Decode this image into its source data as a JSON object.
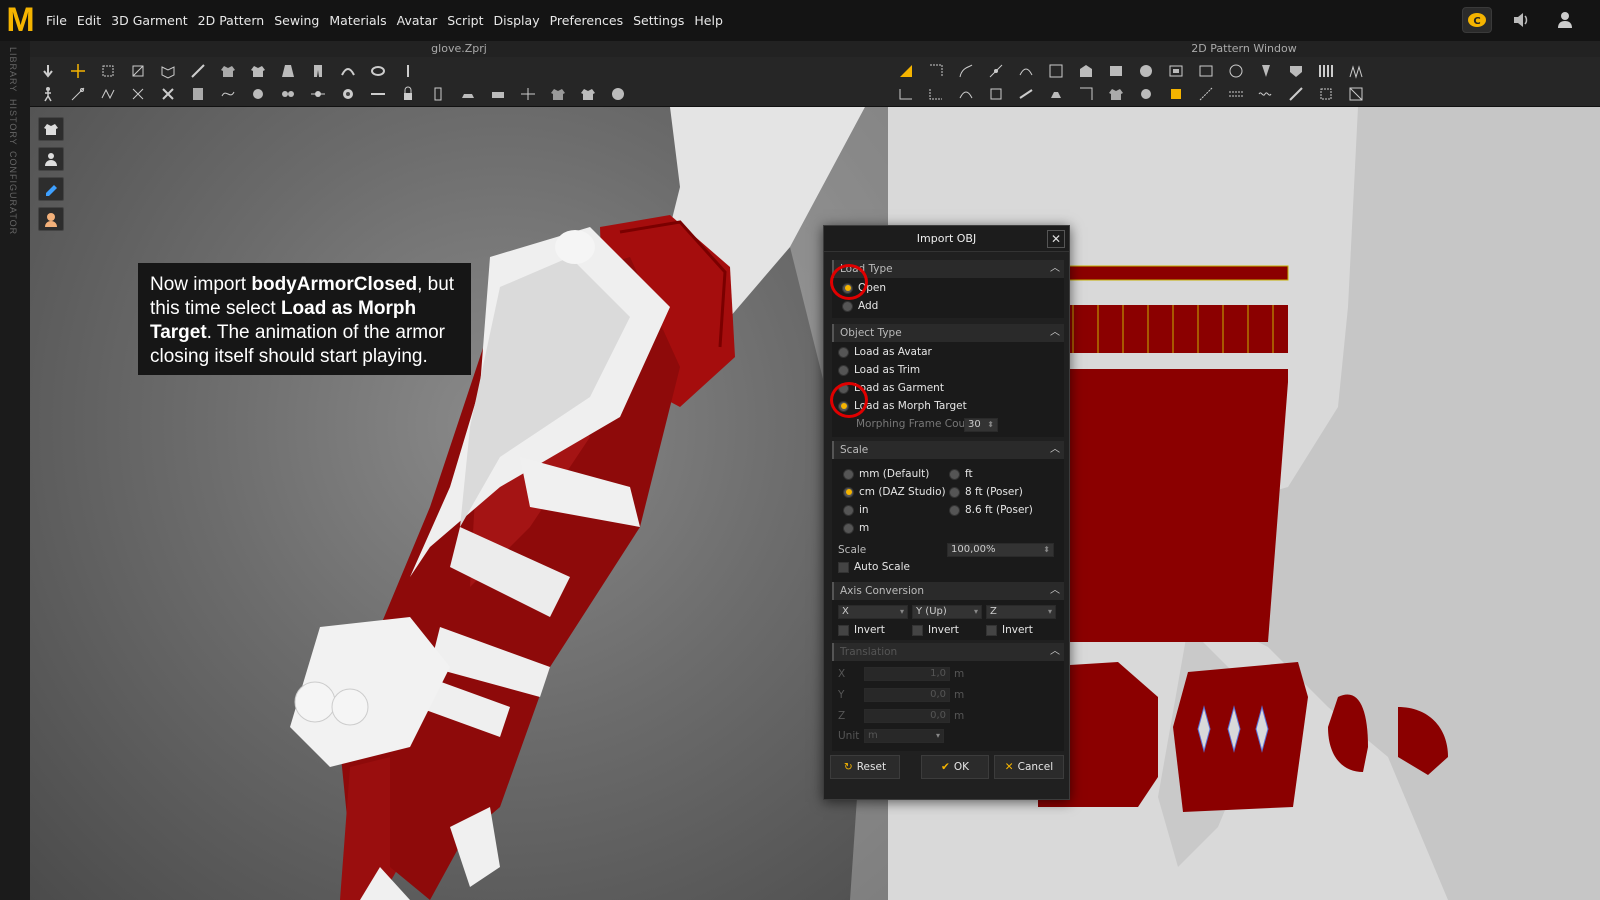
{
  "menubar": {
    "logo": "M",
    "items": [
      "File",
      "Edit",
      "3D Garment",
      "2D Pattern",
      "Sewing",
      "Materials",
      "Avatar",
      "Script",
      "Display",
      "Preferences",
      "Settings",
      "Help"
    ]
  },
  "sidetabs": [
    "LIBRARY",
    "HISTORY",
    "CONFIGURATOR"
  ],
  "window3d": {
    "title": "glove.Zprj"
  },
  "window2d": {
    "title": "2D Pattern Window"
  },
  "callout": {
    "p1": "Now import ",
    "b1": "bodyArmorClosed",
    "p2": ", but this time select ",
    "b2": "Load as Morph Target",
    "p3": ". The animation of the armor closing itself should start playing."
  },
  "dialog": {
    "title": "Import OBJ",
    "load_type": {
      "header": "Load Type",
      "open": "Open",
      "add": "Add"
    },
    "object_type": {
      "header": "Object Type",
      "avatar": "Load as Avatar",
      "trim": "Load as Trim",
      "garment": "Load as Garment",
      "morph": "Load as Morph Target",
      "frame_label": "Morphing Frame Count",
      "frame_value": "30"
    },
    "scale": {
      "header": "Scale",
      "mm": "mm (Default)",
      "cm": "cm (DAZ Studio)",
      "in": "in",
      "m": "m",
      "ft": "ft",
      "ft8": "8 ft (Poser)",
      "ft86": "8.6 ft (Poser)",
      "scale_label": "Scale",
      "scale_value": "100,00%",
      "auto_scale": "Auto Scale"
    },
    "axis": {
      "header": "Axis Conversion",
      "x": "X",
      "y": "Y (Up)",
      "z": "Z",
      "invert": "Invert"
    },
    "translation": {
      "header": "Translation",
      "x_label": "X",
      "x_value": "1,0",
      "y_label": "Y",
      "y_value": "0,0",
      "z_label": "Z",
      "z_value": "0,0",
      "unit_m": "m",
      "unit_label": "Unit",
      "unit_value": "m"
    },
    "buttons": {
      "reset": "Reset",
      "ok": "OK",
      "cancel": "Cancel"
    }
  },
  "colors": {
    "accent": "#f5b400",
    "fabric": "#8b0000",
    "annotation": "#e00000"
  }
}
